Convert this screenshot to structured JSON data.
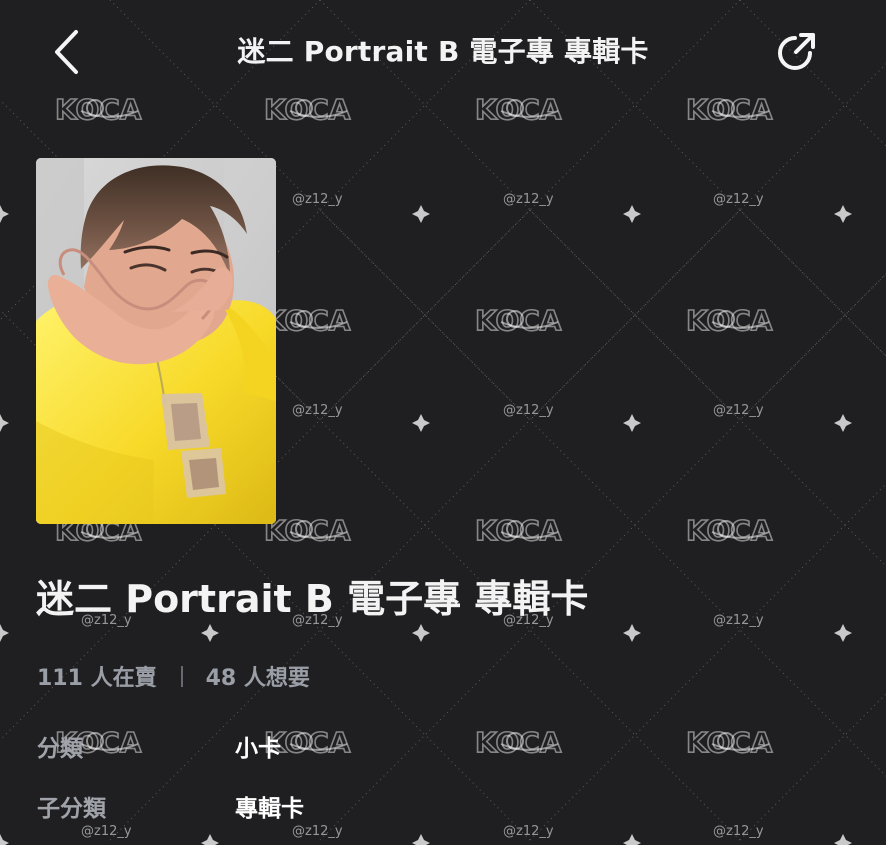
{
  "colors": {
    "background": "#1f1f21",
    "primary_text": "#f3f3f3",
    "muted_text": "#9a9ea6",
    "watermark": "#d9d9d9"
  },
  "header": {
    "back_icon": "chevron-left-icon",
    "title": "迷二 Portrait B 電子專 專輯卡",
    "share_icon": "share-arrow-icon"
  },
  "watermarks": {
    "brand": "KOCA",
    "handle": "@z12_y"
  },
  "product": {
    "image_description": "yellow T-shirt photocard",
    "title": "迷二 Portrait B 電子專 專輯卡"
  },
  "stats": {
    "selling": "111 人在賣",
    "wanting": "48 人想要"
  },
  "details": [
    {
      "label": "分類",
      "value": "小卡"
    },
    {
      "label": "子分類",
      "value": "專輯卡"
    }
  ]
}
